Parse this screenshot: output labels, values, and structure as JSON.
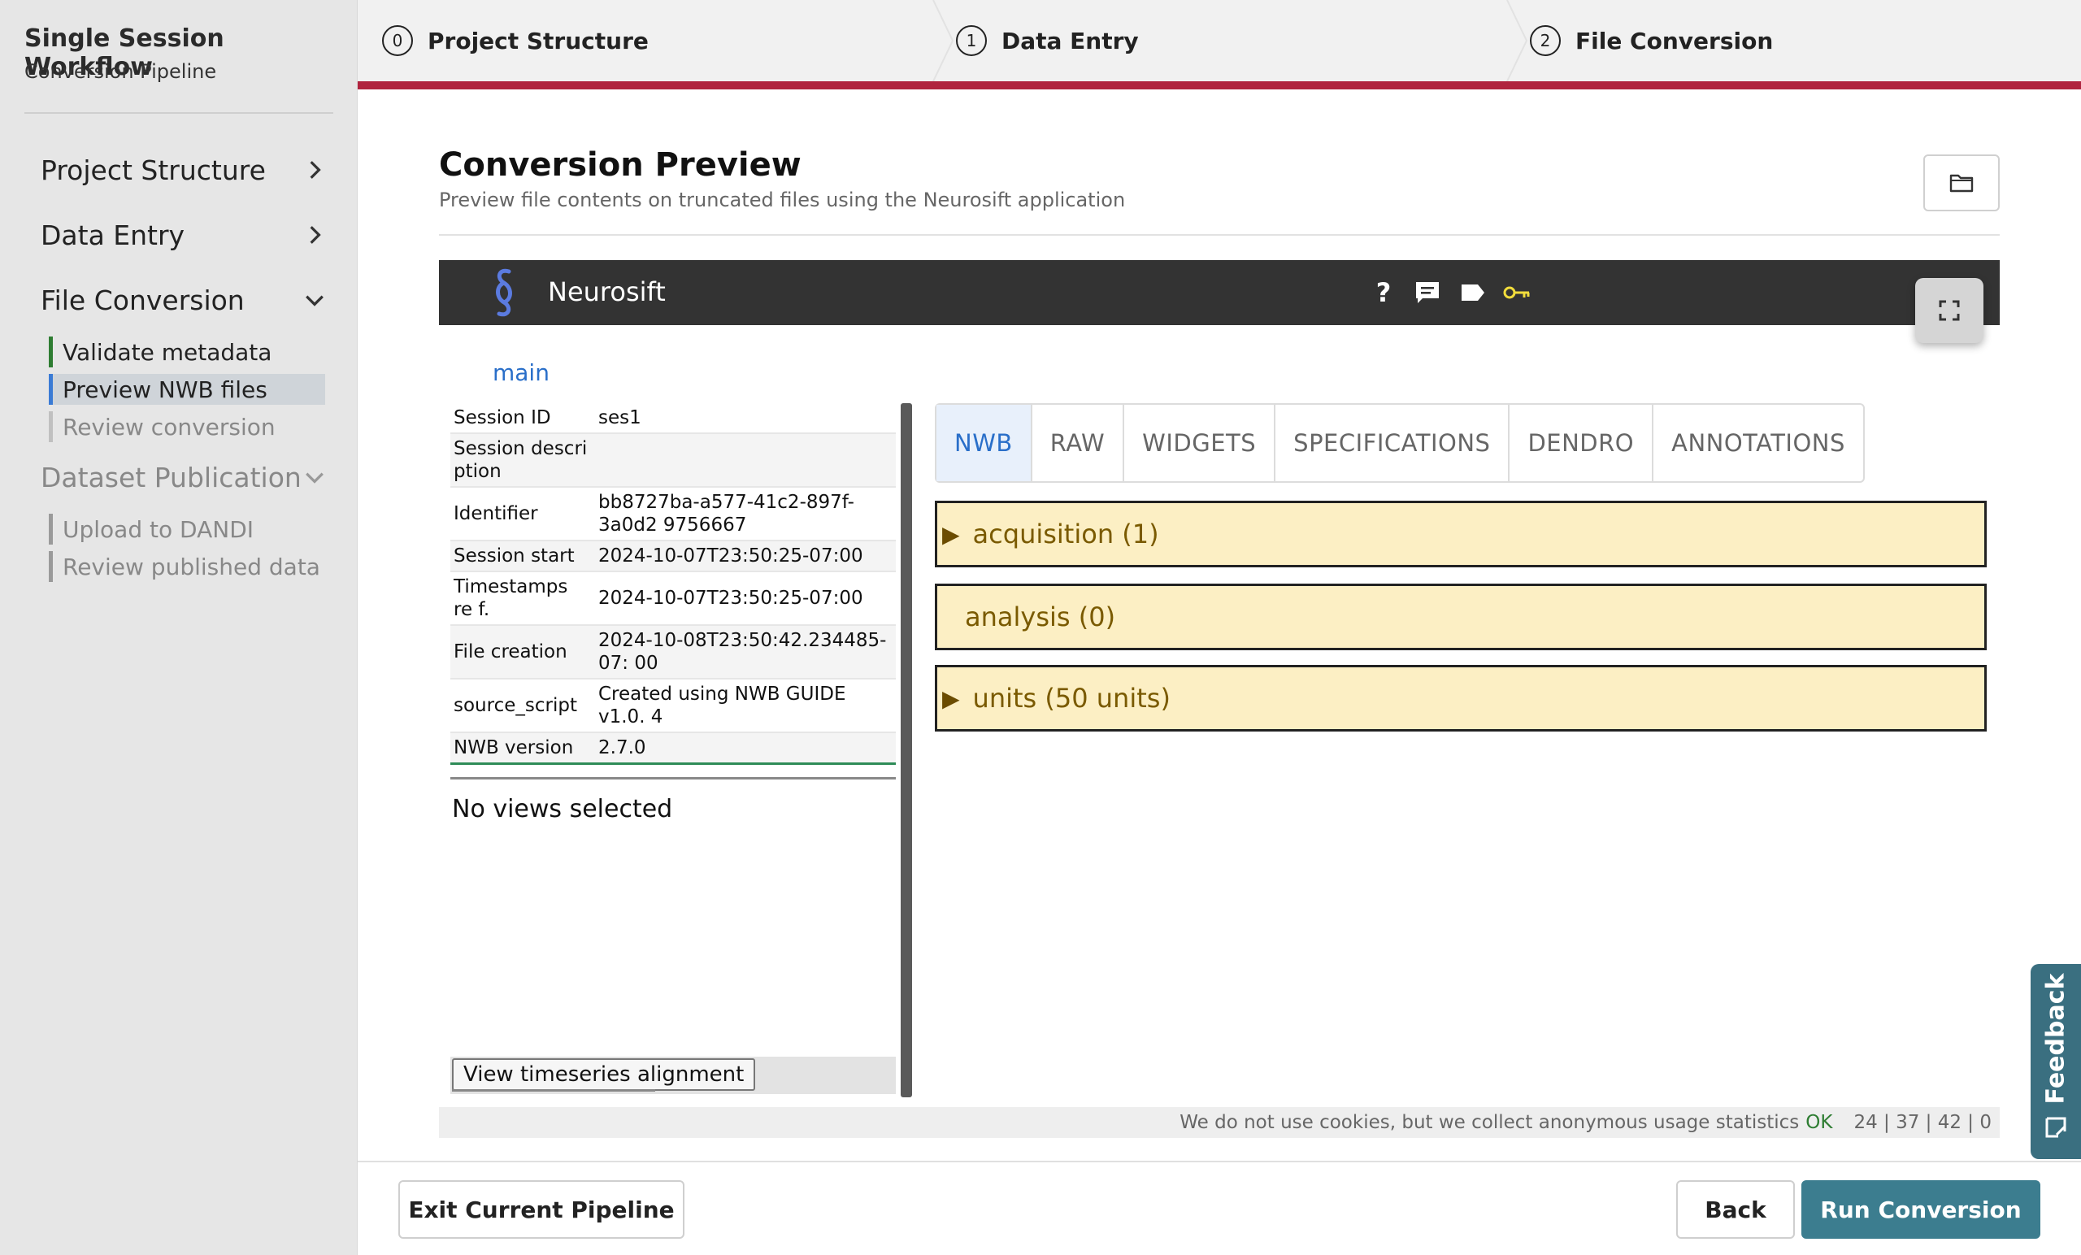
{
  "sidebar": {
    "title": "Single Session Workflow",
    "subtitle": "Conversion Pipeline",
    "sections": [
      {
        "label": "Project Structure"
      },
      {
        "label": "Data Entry"
      },
      {
        "label": "File Conversion"
      },
      {
        "label": "Dataset Publication"
      }
    ],
    "file_conversion_items": [
      "Validate metadata",
      "Preview NWB files",
      "Review conversion"
    ],
    "publication_items": [
      "Upload to DANDI",
      "Review published data"
    ]
  },
  "stepper": {
    "steps": [
      {
        "num": "0",
        "label": "Project Structure"
      },
      {
        "num": "1",
        "label": "Data Entry"
      },
      {
        "num": "2",
        "label": "File Conversion"
      }
    ]
  },
  "main": {
    "title": "Conversion Preview",
    "subtitle": "Preview file contents on truncated files using the Neurosift application"
  },
  "neurosift": {
    "app_name": "Neurosift",
    "help_glyph": "?",
    "breadcrumb": "main",
    "metadata": [
      {
        "key": "Session ID",
        "value": "ses1"
      },
      {
        "key": "Session descri ption",
        "value": ""
      },
      {
        "key": "Identifier",
        "value": "bb8727ba-a577-41c2-897f-3a0d2 9756667"
      },
      {
        "key": "Session start",
        "value": "2024-10-07T23:50:25-07:00"
      },
      {
        "key": "Timestamps re f.",
        "value": "2024-10-07T23:50:25-07:00"
      },
      {
        "key": "File creation",
        "value": "2024-10-08T23:50:42.234485-07: 00"
      },
      {
        "key": "source_script",
        "value": "Created using NWB GUIDE v1.0. 4"
      },
      {
        "key": "NWB version",
        "value": "2.7.0"
      }
    ],
    "no_views": "No views selected",
    "timeseries_button": "View timeseries alignment",
    "tabs": [
      "NWB",
      "RAW",
      "WIDGETS",
      "SPECIFICATIONS",
      "DENDRO",
      "ANNOTATIONS"
    ],
    "active_tab": "NWB",
    "groups": [
      {
        "label": "acquisition (1)",
        "expandable": true
      },
      {
        "label": "analysis (0)",
        "expandable": false
      },
      {
        "label": "units (50 units)",
        "expandable": true
      }
    ],
    "cookie_text": "We do not use cookies, but we collect anonymous usage statistics",
    "cookie_ok": "OK",
    "stats": "24 | 37 | 42 | 0"
  },
  "footer": {
    "exit_label": "Exit Current Pipeline",
    "back_label": "Back",
    "run_label": "Run Conversion"
  },
  "feedback_label": "Feedback",
  "colors": {
    "stepper_accent": "#b0243f",
    "primary_button": "#3c7d8f",
    "group_fill": "#fcefc4",
    "link_blue": "#2a6fc9"
  },
  "icons": [
    "chevron-right-icon",
    "chevron-down-icon",
    "folder-icon",
    "neurosift-logo",
    "help-icon",
    "chat-icon",
    "tag-icon",
    "key-icon",
    "fullscreen-icon",
    "feedback-icon"
  ]
}
